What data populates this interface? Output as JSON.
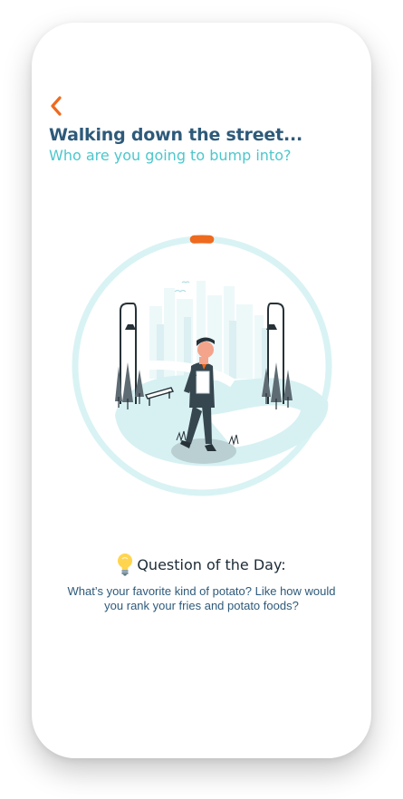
{
  "header": {
    "title": "Walking down the street...",
    "subtitle": "Who are you going to bump into?"
  },
  "icons": {
    "back": "chevron-left-icon",
    "bulb": "lightbulb-icon"
  },
  "timer": {
    "progress": 0.02
  },
  "question_of_the_day": {
    "label": "Question of the Day:",
    "text": "What’s your favorite kind of potato? Like how would you rank your fries and potato foods?"
  },
  "colors": {
    "accent": "#ee6a1f",
    "title": "#2e5a7a",
    "subtitle": "#4cc7cc",
    "ring": "#d9f3f4"
  }
}
